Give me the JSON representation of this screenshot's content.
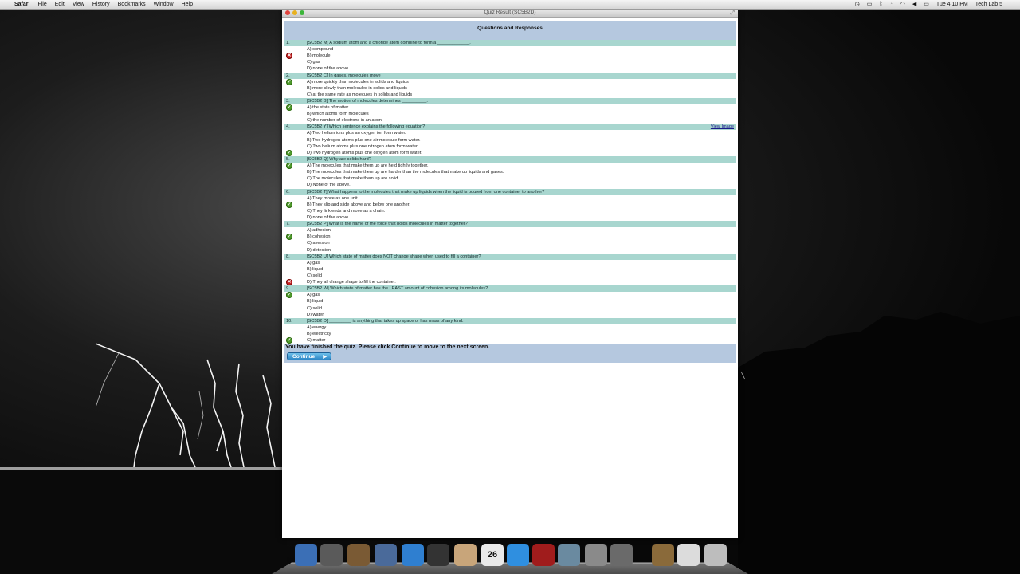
{
  "menubar": {
    "apple": "",
    "app": "Safari",
    "menus": [
      "File",
      "Edit",
      "View",
      "History",
      "Bookmarks",
      "Window",
      "Help"
    ],
    "clock": "Tue 4:10 PM",
    "user": "Tech Lab 5"
  },
  "window": {
    "title": "Quiz Result (SC5B2D)"
  },
  "quiz": {
    "heading": "Questions and Responses",
    "questions": [
      {
        "num": "1.",
        "text": "[SC5B2 M] A sodium atom and a chloride atom combine to form a _____________.",
        "answers": [
          "A) compound",
          "B) molecule",
          "C) gas",
          "D) none of the above"
        ],
        "mark_index": 1,
        "mark": "bad"
      },
      {
        "num": "2.",
        "text": "[SC5B2 C] In gases, molecules move _____",
        "answers": [
          "A) more quickly than molecules in solids and liquids",
          "B) more slowly than molecules in solids and liquids",
          "C) at the same rate as molecules in solids and liquids"
        ],
        "mark_index": 0,
        "mark": "ok"
      },
      {
        "num": "3.",
        "text": "[SC5B2 B] The motion of molecules determines __________.",
        "answers": [
          "A) the state of matter",
          "B) which atoms form molecules",
          "C) the number of electrons in an atom"
        ],
        "mark_index": 0,
        "mark": "ok"
      },
      {
        "num": "4.",
        "text": "[SC5B2 Y] Which sentence explains the following equation?",
        "link": "View Image",
        "answers": [
          "A) Two helium ions plus an oxygen ion form water.",
          "B) Two hydrogen atoms plus one air molecule form water.",
          "C) Two helium atoms plus one nitrogen atom form water.",
          "D) Two hydrogen atoms plus one oxygen atom form water."
        ],
        "mark_index": 3,
        "mark": "ok"
      },
      {
        "num": "5.",
        "text": "[SC5B2 Q] Why are solids hard?",
        "answers": [
          "A) The molecules that make them up are held tightly together.",
          "B) The molecules that make them up are harder than the molecules that make up liquids and gases.",
          "C) The molecules that make them up are solid.",
          "D) None of the above."
        ],
        "mark_index": 0,
        "mark": "ok"
      },
      {
        "num": "6.",
        "text": "[SC5B2 T] What happens to the molecules that make up liquids when the liquid is poured from one container to another?",
        "answers": [
          "A) They move as one unit.",
          "B) They slip and slide above and below one another.",
          "C) They link ends and move as a chain.",
          "D) none of the above"
        ],
        "mark_index": 1,
        "mark": "ok"
      },
      {
        "num": "7.",
        "text": "[SC5B2 P] What is the name of the force that holds molecules in matter together?",
        "answers": [
          "A) adhesion",
          "B) cohesion",
          "C) aversion",
          "D) detection"
        ],
        "mark_index": 1,
        "mark": "ok"
      },
      {
        "num": "8.",
        "text": "[SC5B2 U] Which state of matter does NOT change shape when used to fill a container?",
        "answers": [
          "A) gas",
          "B) liquid",
          "C) solid",
          "D) They all change shape to fill the container."
        ],
        "mark_index": 3,
        "mark": "bad"
      },
      {
        "num": "9.",
        "text": "[SC5B2 W] Which state of matter has the LEAST amount of cohesion among its molecules?",
        "answers": [
          "A) gas",
          "B) liquid",
          "C) solid",
          "D) water"
        ],
        "mark_index": 0,
        "mark": "ok"
      },
      {
        "num": "10.",
        "text": "[SC5B2 D] _________ is anything that takes up space or has mass of any kind.",
        "answers": [
          "A) energy",
          "B) electricity",
          "C) matter"
        ],
        "mark_index": 2,
        "mark": "ok"
      }
    ],
    "finish_message": "You have finished the quiz. Please click Continue to move to the next screen.",
    "continue_label": "Continue"
  },
  "dock": {
    "calendar_day": "26",
    "icons": [
      "finder-icon",
      "launchpad-icon",
      "photo-icon",
      "preview-icon",
      "safari-icon",
      "camera-icon",
      "address-book-icon",
      "calendar-icon",
      "itunes-icon",
      "photo-booth-icon",
      "iphoto-icon",
      "system-preferences-icon",
      "imovie-icon",
      "downloads-icon",
      "document-icon",
      "trash-icon"
    ]
  },
  "colors": {
    "question_bar": "#a8d6cf",
    "header_bar": "#b5c8df",
    "correct": "#4e9a2a",
    "incorrect": "#c62525"
  }
}
